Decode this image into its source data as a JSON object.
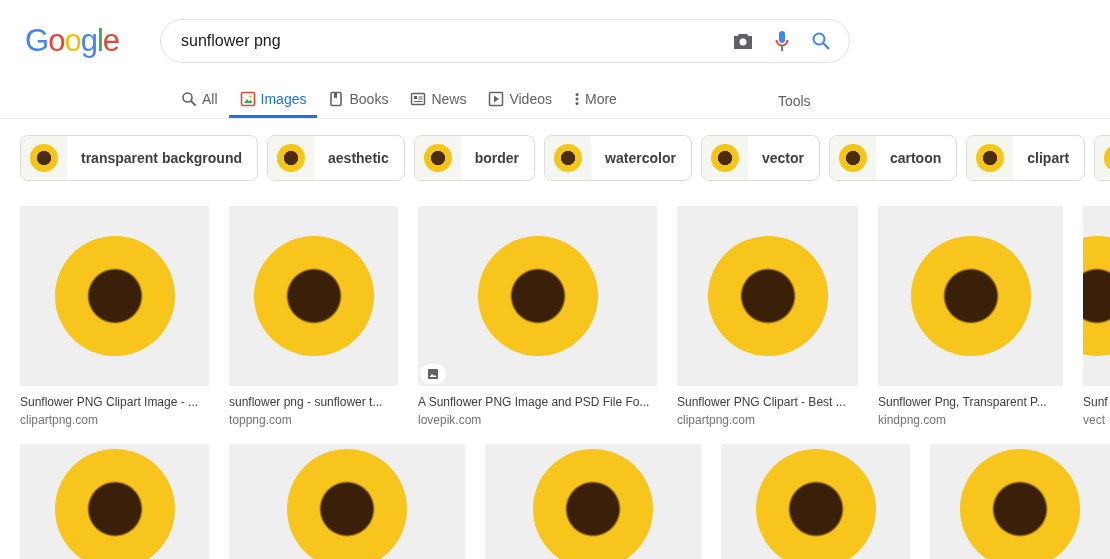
{
  "logo": "Google",
  "search": {
    "value": "sunflower png"
  },
  "tabs": [
    {
      "label": "All",
      "kind": "search",
      "selected": false
    },
    {
      "label": "Images",
      "kind": "image",
      "selected": true
    },
    {
      "label": "Books",
      "kind": "book",
      "selected": false
    },
    {
      "label": "News",
      "kind": "news",
      "selected": false
    },
    {
      "label": "Videos",
      "kind": "video",
      "selected": false
    },
    {
      "label": "More",
      "kind": "more",
      "selected": false
    }
  ],
  "tools": "Tools",
  "chips": [
    {
      "kind": "text",
      "label": "transparent background"
    },
    {
      "kind": "text",
      "label": "aesthetic"
    },
    {
      "kind": "text",
      "label": "border"
    },
    {
      "kind": "text",
      "label": "watercolor"
    },
    {
      "kind": "text",
      "label": "vector"
    },
    {
      "kind": "text",
      "label": "cartoon"
    },
    {
      "kind": "text",
      "label": "clipart"
    },
    {
      "kind": "thumbnail"
    }
  ],
  "results": [
    [
      {
        "title": "Sunflower PNG Clipart Image - ...",
        "source": "clipartpng.com"
      },
      {
        "title": "sunflower png - sunflower t...",
        "source": "toppng.com"
      },
      {
        "title": "A Sunflower PNG Image and PSD File Fo...",
        "source": "lovepik.com",
        "badge": true
      },
      {
        "title": "Sunflower PNG Clipart - Best ...",
        "source": "clipartpng.com"
      },
      {
        "title": "Sunflower Png, Transparent P...",
        "source": "kindpng.com"
      },
      {
        "title": "Sunf",
        "source": "vect"
      }
    ],
    [
      {
        "kind": "photo"
      },
      {
        "kind": "photo"
      },
      {
        "kind": "photo"
      },
      {
        "kind": "photo"
      },
      {
        "kind": "photo"
      }
    ]
  ]
}
